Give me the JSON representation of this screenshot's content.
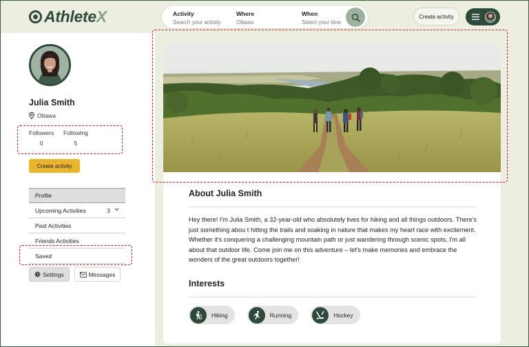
{
  "brand": {
    "name_main": "Athlete",
    "name_accent": "X"
  },
  "search": {
    "activity_label": "Activity",
    "activity_value": "Search your activity",
    "where_label": "Where",
    "where_value": "Ottawa",
    "when_label": "When",
    "when_value": "Select your time"
  },
  "header": {
    "create_activity": "Create activity"
  },
  "profile": {
    "name": "Julia Smith",
    "location": "Ottawa",
    "followers_label": "Followers",
    "followers": "0",
    "following_label": "Following",
    "following": "5",
    "create_activity": "Create activity"
  },
  "menu": {
    "profile": "Profile",
    "upcoming": "Upcoming Activities",
    "upcoming_count": "3",
    "past": "Past Activities",
    "friends": "Friends Activities",
    "saved": "Saved"
  },
  "buttons": {
    "settings": "Settings",
    "messages": "Messages"
  },
  "about": {
    "title": "About Julia Smith",
    "bio": "Hey there! I'm Julia Smith, a 32-year-old who absolutely lives for hiking and all things outdoors. There's just something abou t hitting the trails and soaking in nature that makes my heart race with excitement. Whether it's conquering a challenging mountain path or just wandering through scenic spots, I'm all about that outdoor life. Come join me on this adventure – let's make memories and embrace the wonders of the great outdoors together!"
  },
  "interests": {
    "title": "Interests",
    "items": [
      "Hiking",
      "Running",
      "Hockey"
    ]
  },
  "colors": {
    "brand": "#2e4a3a",
    "accent": "#eab42b",
    "annotation": "#d8121b"
  }
}
